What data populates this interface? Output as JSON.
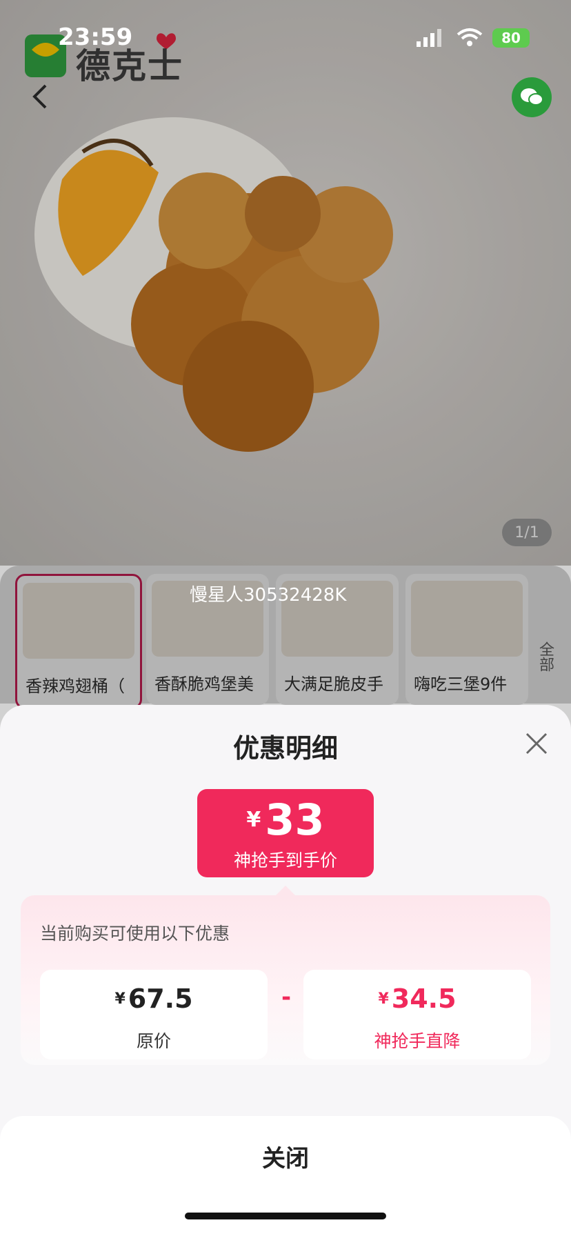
{
  "status_bar": {
    "time": "23:59",
    "battery": "80"
  },
  "hero": {
    "brand_name": "德克士",
    "page_indicator": "1/1",
    "watermark_user": "慢星人30532428K"
  },
  "products": [
    {
      "name": "香辣鸡翅桶（",
      "selected": true
    },
    {
      "name": "香酥脆鸡堡美",
      "selected": false
    },
    {
      "name": "大满足脆皮手",
      "selected": false
    },
    {
      "name": "嗨吃三堡9件",
      "selected": false
    }
  ],
  "all_button": "全部",
  "sheet": {
    "title": "优惠明细",
    "final_price": {
      "currency": "¥",
      "value": "33",
      "label": "神抢手到手价"
    },
    "caption": "当前购买可使用以下优惠",
    "original": {
      "currency": "¥",
      "value": "67.5",
      "label": "原价"
    },
    "minus": "-",
    "discount": {
      "currency": "¥",
      "value": "34.5",
      "label": "神抢手直降"
    },
    "close_label": "关闭"
  },
  "colors": {
    "accent": "#f0295b",
    "brand_green": "#2a9b3b"
  }
}
